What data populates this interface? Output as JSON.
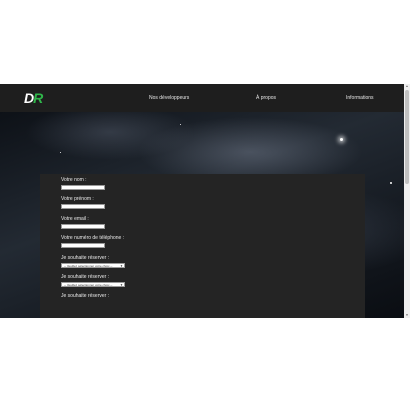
{
  "navbar": {
    "logo_left": "D",
    "logo_right": "R",
    "links": [
      "Nos développeurs",
      "À propos",
      "Informations"
    ]
  },
  "form": {
    "name_label": "Votre nom :",
    "firstname_label": "Votre prénom :",
    "email_label": "Votre email :",
    "phone_label": "Votre numéro de téléphone :",
    "reserve_label_1": "Je souhaite réserver :",
    "reserve_label_2": "Je souhaite réserver :",
    "reserve_label_3": "Je souhaite réserver :",
    "select_placeholder": "-- Veuillez sélectionner votre choix --"
  },
  "colors": {
    "accent_green": "#2fb54a",
    "navbar_bg": "#1e1e1e",
    "panel_bg": "#242424"
  }
}
